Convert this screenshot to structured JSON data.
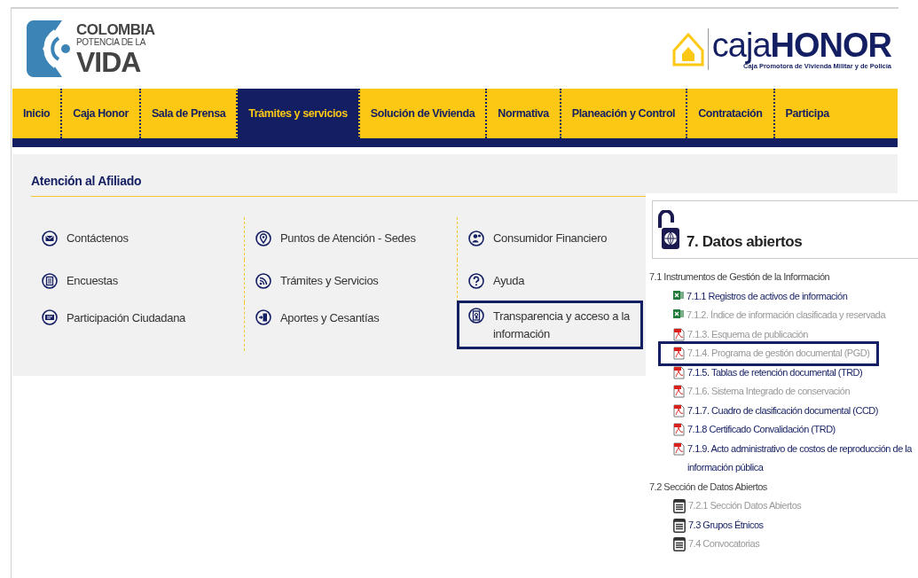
{
  "header": {
    "brand_left": {
      "line1": "COLOMBIA",
      "line2": "POTENCIA DE LA",
      "line3": "VIDA"
    },
    "brand_right": {
      "name_light": "caja",
      "name_bold": "HONOR",
      "tagline": "Caja Promotora de Vivienda Militar y de Policía"
    }
  },
  "nav": [
    {
      "label": "Inicio",
      "selected": false
    },
    {
      "label": "Caja Honor",
      "selected": false
    },
    {
      "label": "Sala de Prensa",
      "selected": false
    },
    {
      "label": "Trámites y servicios",
      "selected": true
    },
    {
      "label": "Solución de Vivienda",
      "selected": false
    },
    {
      "label": "Normativa",
      "selected": false
    },
    {
      "label": "Planeación y Control",
      "selected": false
    },
    {
      "label": "Contratación",
      "selected": false
    },
    {
      "label": "Participa",
      "selected": false
    }
  ],
  "section": {
    "title": "Atención al Afiliado",
    "links": [
      {
        "kind": "mail",
        "label": "Contáctenos",
        "highlighted": false
      },
      {
        "kind": "pin",
        "label": "Puntos de Atención - Sedes",
        "highlighted": false
      },
      {
        "kind": "person",
        "label": "Consumidor Financiero",
        "highlighted": false
      },
      {
        "kind": "list",
        "label": "Encuestas",
        "highlighted": false
      },
      {
        "kind": "rss",
        "label": "Trámites y Servicios",
        "highlighted": false
      },
      {
        "kind": "help",
        "label": "Ayuda",
        "highlighted": false
      },
      {
        "kind": "chat",
        "label": "Participación Ciudadana",
        "highlighted": false
      },
      {
        "kind": "deposit",
        "label": "Aportes y Cesantías",
        "highlighted": false
      },
      {
        "kind": "lockdoc",
        "label": "Transparencia y acceso a la información",
        "highlighted": true
      }
    ]
  },
  "open_data": {
    "title": "7. Datos abiertos",
    "items": [
      {
        "kind": "heading",
        "label": "7.1 Instrumentos de Gestión de la Información",
        "dimmed": false,
        "highlighted": false
      },
      {
        "kind": "excel",
        "label": "7.1.1 Registros de activos de información",
        "dimmed": false,
        "highlighted": false
      },
      {
        "kind": "excel",
        "label": "7.1.2. Índice de información clasificada y reservada",
        "dimmed": true,
        "highlighted": false
      },
      {
        "kind": "pdf",
        "label": "7.1.3. Esquema de publicación",
        "dimmed": true,
        "highlighted": false
      },
      {
        "kind": "pdf",
        "label": "7.1.4. Programa de gestión documental (PGD)",
        "dimmed": true,
        "highlighted": true
      },
      {
        "kind": "pdf",
        "label": "7.1.5. Tablas de retención documental (TRD)",
        "dimmed": false,
        "highlighted": false
      },
      {
        "kind": "pdf",
        "label": "7.1.6. Sistema Integrado de conservación",
        "dimmed": true,
        "highlighted": false
      },
      {
        "kind": "pdf",
        "label": "7.1.7. Cuadro de clasificación documental (CCD)",
        "dimmed": false,
        "highlighted": false
      },
      {
        "kind": "pdf",
        "label": "7.1.8 Certificado Convalidación (TRD)",
        "dimmed": false,
        "highlighted": false
      },
      {
        "kind": "pdf",
        "label": "7.1.9. Acto administrativo de costos de reproducción de la información pública",
        "dimmed": false,
        "highlighted": false
      },
      {
        "kind": "heading",
        "label": "7.2 Sección de Datos Abiertos",
        "dimmed": false,
        "highlighted": false
      },
      {
        "kind": "table",
        "label": "7.2.1 Sección Datos Abiertos",
        "dimmed": true,
        "highlighted": false
      },
      {
        "kind": "table",
        "label": "7.3 Grupos Étnicos",
        "dimmed": false,
        "highlighted": false
      },
      {
        "kind": "table",
        "label": "7.4 Convocatorias",
        "dimmed": true,
        "highlighted": false
      }
    ]
  }
}
